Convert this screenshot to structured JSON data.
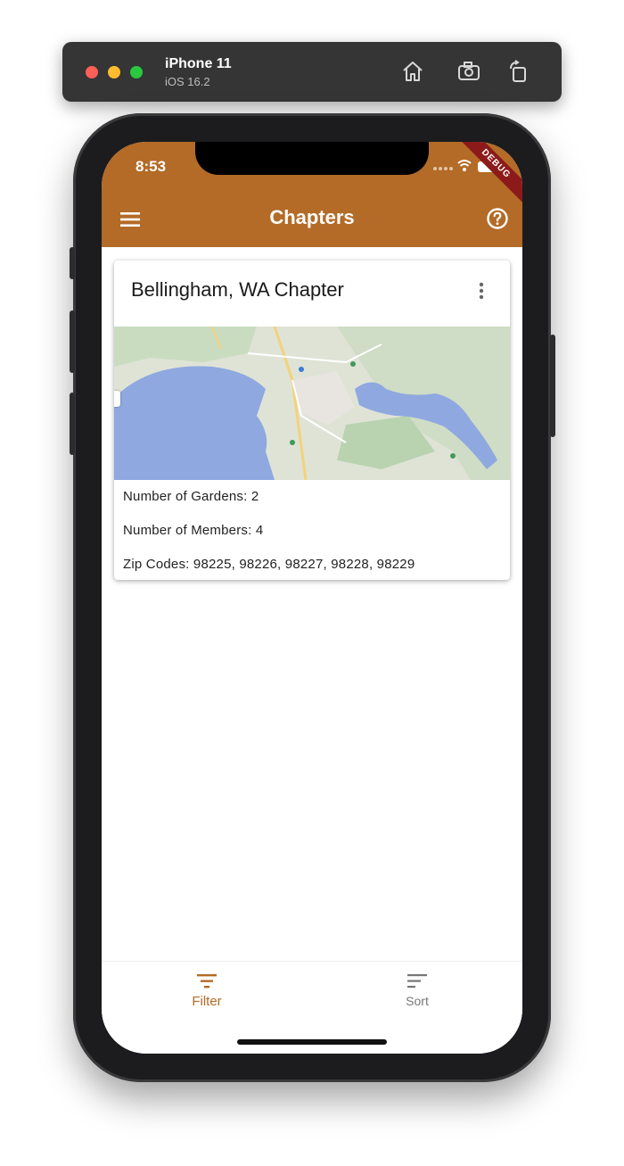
{
  "simulator": {
    "device": "iPhone 11",
    "os": "iOS 16.2",
    "icons": [
      "home-icon",
      "screenshot-icon",
      "rotate-icon"
    ]
  },
  "status_bar": {
    "time": "8:53",
    "debug_banner": "DEBUG"
  },
  "app_bar": {
    "title": "Chapters",
    "accent": "#b36b27"
  },
  "chapters": [
    {
      "name": "Bellingham, WA Chapter",
      "gardens": "Number of Gardens: 2",
      "members": "Number of Members: 4",
      "zip_codes": "Zip Codes: 98225, 98226, 98227, 98228, 98229"
    }
  ],
  "bottom_nav": {
    "filter_label": "Filter",
    "sort_label": "Sort",
    "active": "filter"
  }
}
